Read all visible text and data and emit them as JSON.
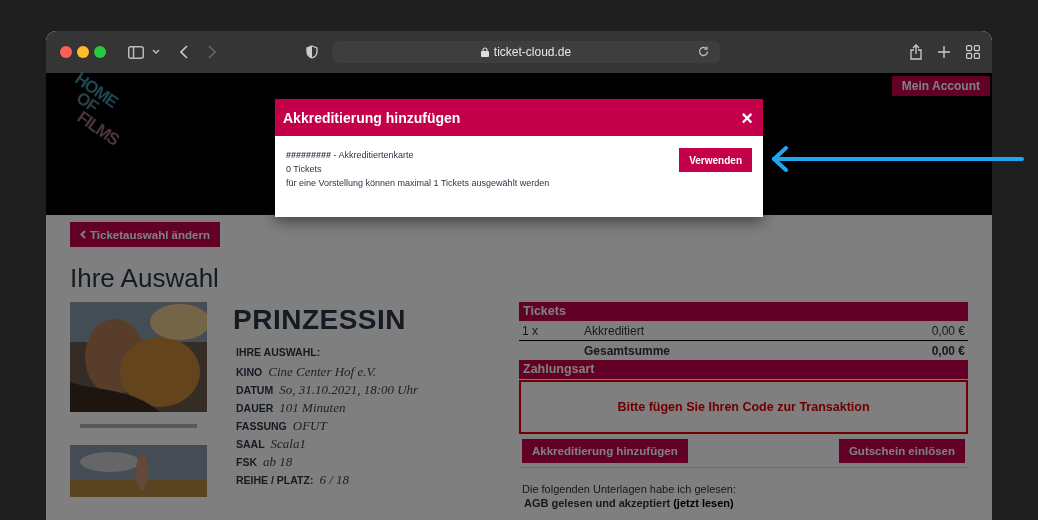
{
  "browser": {
    "url": "ticket-cloud.de",
    "nav_buttons": [
      {
        "kind": "back",
        "disabled": false
      },
      {
        "kind": "forward",
        "disabled": true
      }
    ]
  },
  "header": {
    "logo": [
      "HOME",
      "OF",
      "FILMS"
    ],
    "account_button": "Mein Account"
  },
  "main": {
    "back_button": "Ticketauswahl ändern",
    "heading": "Ihre Auswahl",
    "film_title": "PRINZESSIN",
    "details_heading": "IHRE AUSWAHL:",
    "details": [
      {
        "label": "KINO",
        "value": "Cine Center Hof e.V."
      },
      {
        "label": "DATUM",
        "value": "So, 31.10.2021, 18:00 Uhr"
      },
      {
        "label": "DAUER",
        "value": "101 Minuten"
      },
      {
        "label": "FASSUNG",
        "value": "OFUT"
      },
      {
        "label": "SAAL",
        "value": "Scala1"
      },
      {
        "label": "FSK",
        "value": "ab 18"
      },
      {
        "label": "REIHE / PLATZ:",
        "value": "6 / 18"
      }
    ]
  },
  "tickets": {
    "title": "Tickets",
    "rows": [
      {
        "quantity": "1 x",
        "type": "Akkreditiert",
        "price": "0,00 €"
      }
    ],
    "total": {
      "label": "Gesamtsumme",
      "price": "0,00 €"
    }
  },
  "payment": {
    "title": "Zahlungsart",
    "message": "Bitte fügen Sie Ihren Code zur Transaktion",
    "buttons": [
      "Akkreditierung hinzufügen",
      "Gutschein einlösen"
    ]
  },
  "terms": {
    "intro": "Die folgenden Unterlagen habe ich gelesen:",
    "agreement": "AGB gelesen und akzeptiert",
    "link": "(jetzt lesen)"
  },
  "modal": {
    "title": "Akkreditierung hinzufügen",
    "close": "×",
    "card": "**#########** - Akkreditiertenkarte",
    "lines": [
      "0 Tickets",
      "für eine Vorstellung können maximal 1 Tickets ausgewählt werden"
    ],
    "button": "Verwenden"
  }
}
